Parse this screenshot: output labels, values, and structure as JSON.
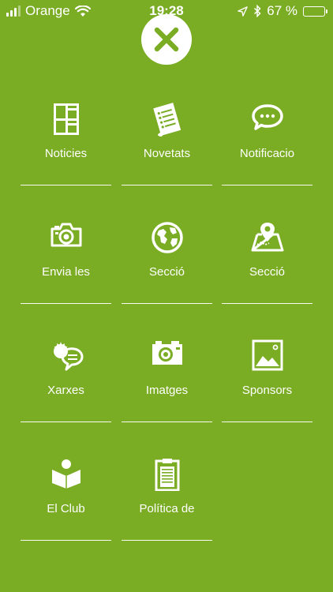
{
  "status_bar": {
    "carrier": "Orange",
    "time": "19:28",
    "battery_percent": "67 %",
    "battery_level": 0.67,
    "battery_color": "#f5c400"
  },
  "theme": {
    "background": "#7aac24",
    "foreground": "#ffffff"
  },
  "close_button": {
    "icon": "close-icon"
  },
  "menu": {
    "items": [
      {
        "label": "Noticies",
        "icon": "newspaper-icon"
      },
      {
        "label": "Novetats",
        "icon": "document-list-icon"
      },
      {
        "label": "Notificacio",
        "icon": "speech-bubble-icon"
      },
      {
        "label": "Envia les",
        "icon": "camera-icon"
      },
      {
        "label": "Secció",
        "icon": "globe-icon"
      },
      {
        "label": "Secció",
        "icon": "map-pin-icon"
      },
      {
        "label": "Xarxes",
        "icon": "social-chat-icon"
      },
      {
        "label": "Imatges",
        "icon": "photo-camera-icon"
      },
      {
        "label": "Sponsors",
        "icon": "picture-frame-icon"
      },
      {
        "label": "El Club",
        "icon": "reader-book-icon"
      },
      {
        "label": "Política de",
        "icon": "clipboard-icon"
      }
    ]
  }
}
